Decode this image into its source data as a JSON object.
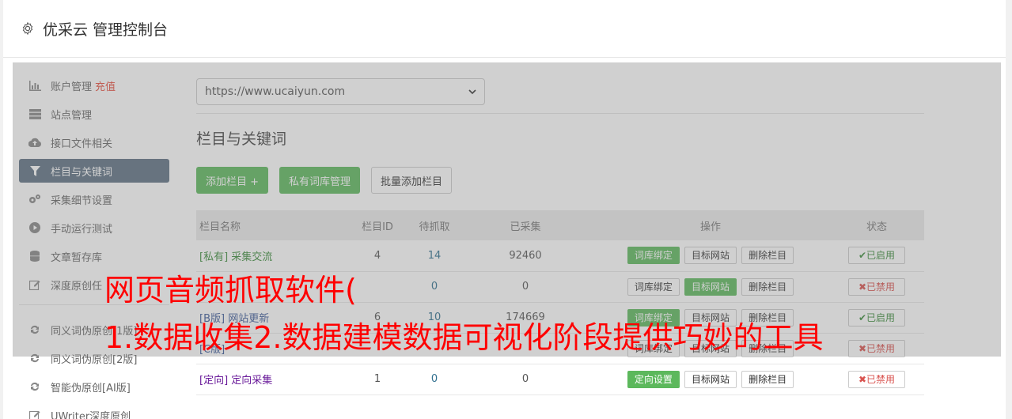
{
  "header": {
    "title": "优采云 管理控制台",
    "icon": "gear-icon"
  },
  "sidebar": {
    "items": [
      {
        "label": "账户管理",
        "extra": "充值",
        "icon": "bar-chart-icon"
      },
      {
        "label": "站点管理",
        "icon": "server-icon"
      },
      {
        "label": "接口文件相关",
        "icon": "cloud-upload-icon"
      },
      {
        "label": "栏目与关键词",
        "icon": "filter-icon",
        "active": true
      },
      {
        "label": "采集细节设置",
        "icon": "gears-icon"
      },
      {
        "label": "手动运行测试",
        "icon": "play-circle-icon"
      },
      {
        "label": "文章暂存库",
        "icon": "database-icon"
      },
      {
        "label": "深度原创任",
        "icon": "edit-icon"
      },
      {
        "label": "同义词伪原创[1版]",
        "icon": "refresh-icon"
      },
      {
        "label": "同义词伪原创[2版]",
        "icon": "refresh-icon"
      },
      {
        "label": "智能伪原创[AI版]",
        "icon": "refresh-icon"
      },
      {
        "label": "UWriter深度原创",
        "icon": "edit-icon"
      }
    ]
  },
  "site_select": {
    "value": "https://www.ucaiyun.com"
  },
  "section_title": "栏目与关键词",
  "buttons": {
    "add_column": "添加栏目 +",
    "private_lib": "私有词库管理",
    "batch_add": "批量添加栏目"
  },
  "table": {
    "headers": [
      "栏目名称",
      "栏目ID",
      "待抓取",
      "已采集",
      "操作",
      "状态"
    ],
    "rows": [
      {
        "prefix": "[私有]",
        "name": "采集交流",
        "id": "4",
        "pending": "14",
        "collected": "92460",
        "op1": "词库绑定",
        "op2": "目标网站",
        "op3": "删除栏目",
        "status": "已启用",
        "on": true
      },
      {
        "prefix": "",
        "name": "",
        "id": "",
        "pending": "0",
        "collected": "0",
        "op1": "词库绑定",
        "op2": "目标网站",
        "op3": "删除栏目",
        "status": "已禁用",
        "on": false
      },
      {
        "prefix": "[B版]",
        "name": "网站更新",
        "id": "6",
        "pending": "10",
        "collected": "174669",
        "op1": "词库绑定",
        "op2": "目标网站",
        "op3": "删除栏目",
        "status": "已启用",
        "on": true
      },
      {
        "prefix": "[C版]",
        "name": "",
        "id": "",
        "pending": "",
        "collected": "",
        "op1": "词库绑定",
        "op2": "目标网站",
        "op3": "删除栏目",
        "status": "已禁用",
        "on": false
      },
      {
        "prefix": "[定向]",
        "name": "定向采集",
        "id": "1",
        "pending": "0",
        "collected": "0",
        "op1": "定向设置",
        "op2": "目标网站",
        "op3": "删除栏目",
        "status": "已禁用",
        "on": false
      }
    ]
  },
  "banner": {
    "line1": "网页音频抓取软件(",
    "line2": "1.数据收集2.数据建模数据可视化阶段提供巧妙的工具"
  },
  "colors": {
    "accent_green": "#5cb85c",
    "active_nav": "#5e7183",
    "banner_red": "#ff0000"
  }
}
